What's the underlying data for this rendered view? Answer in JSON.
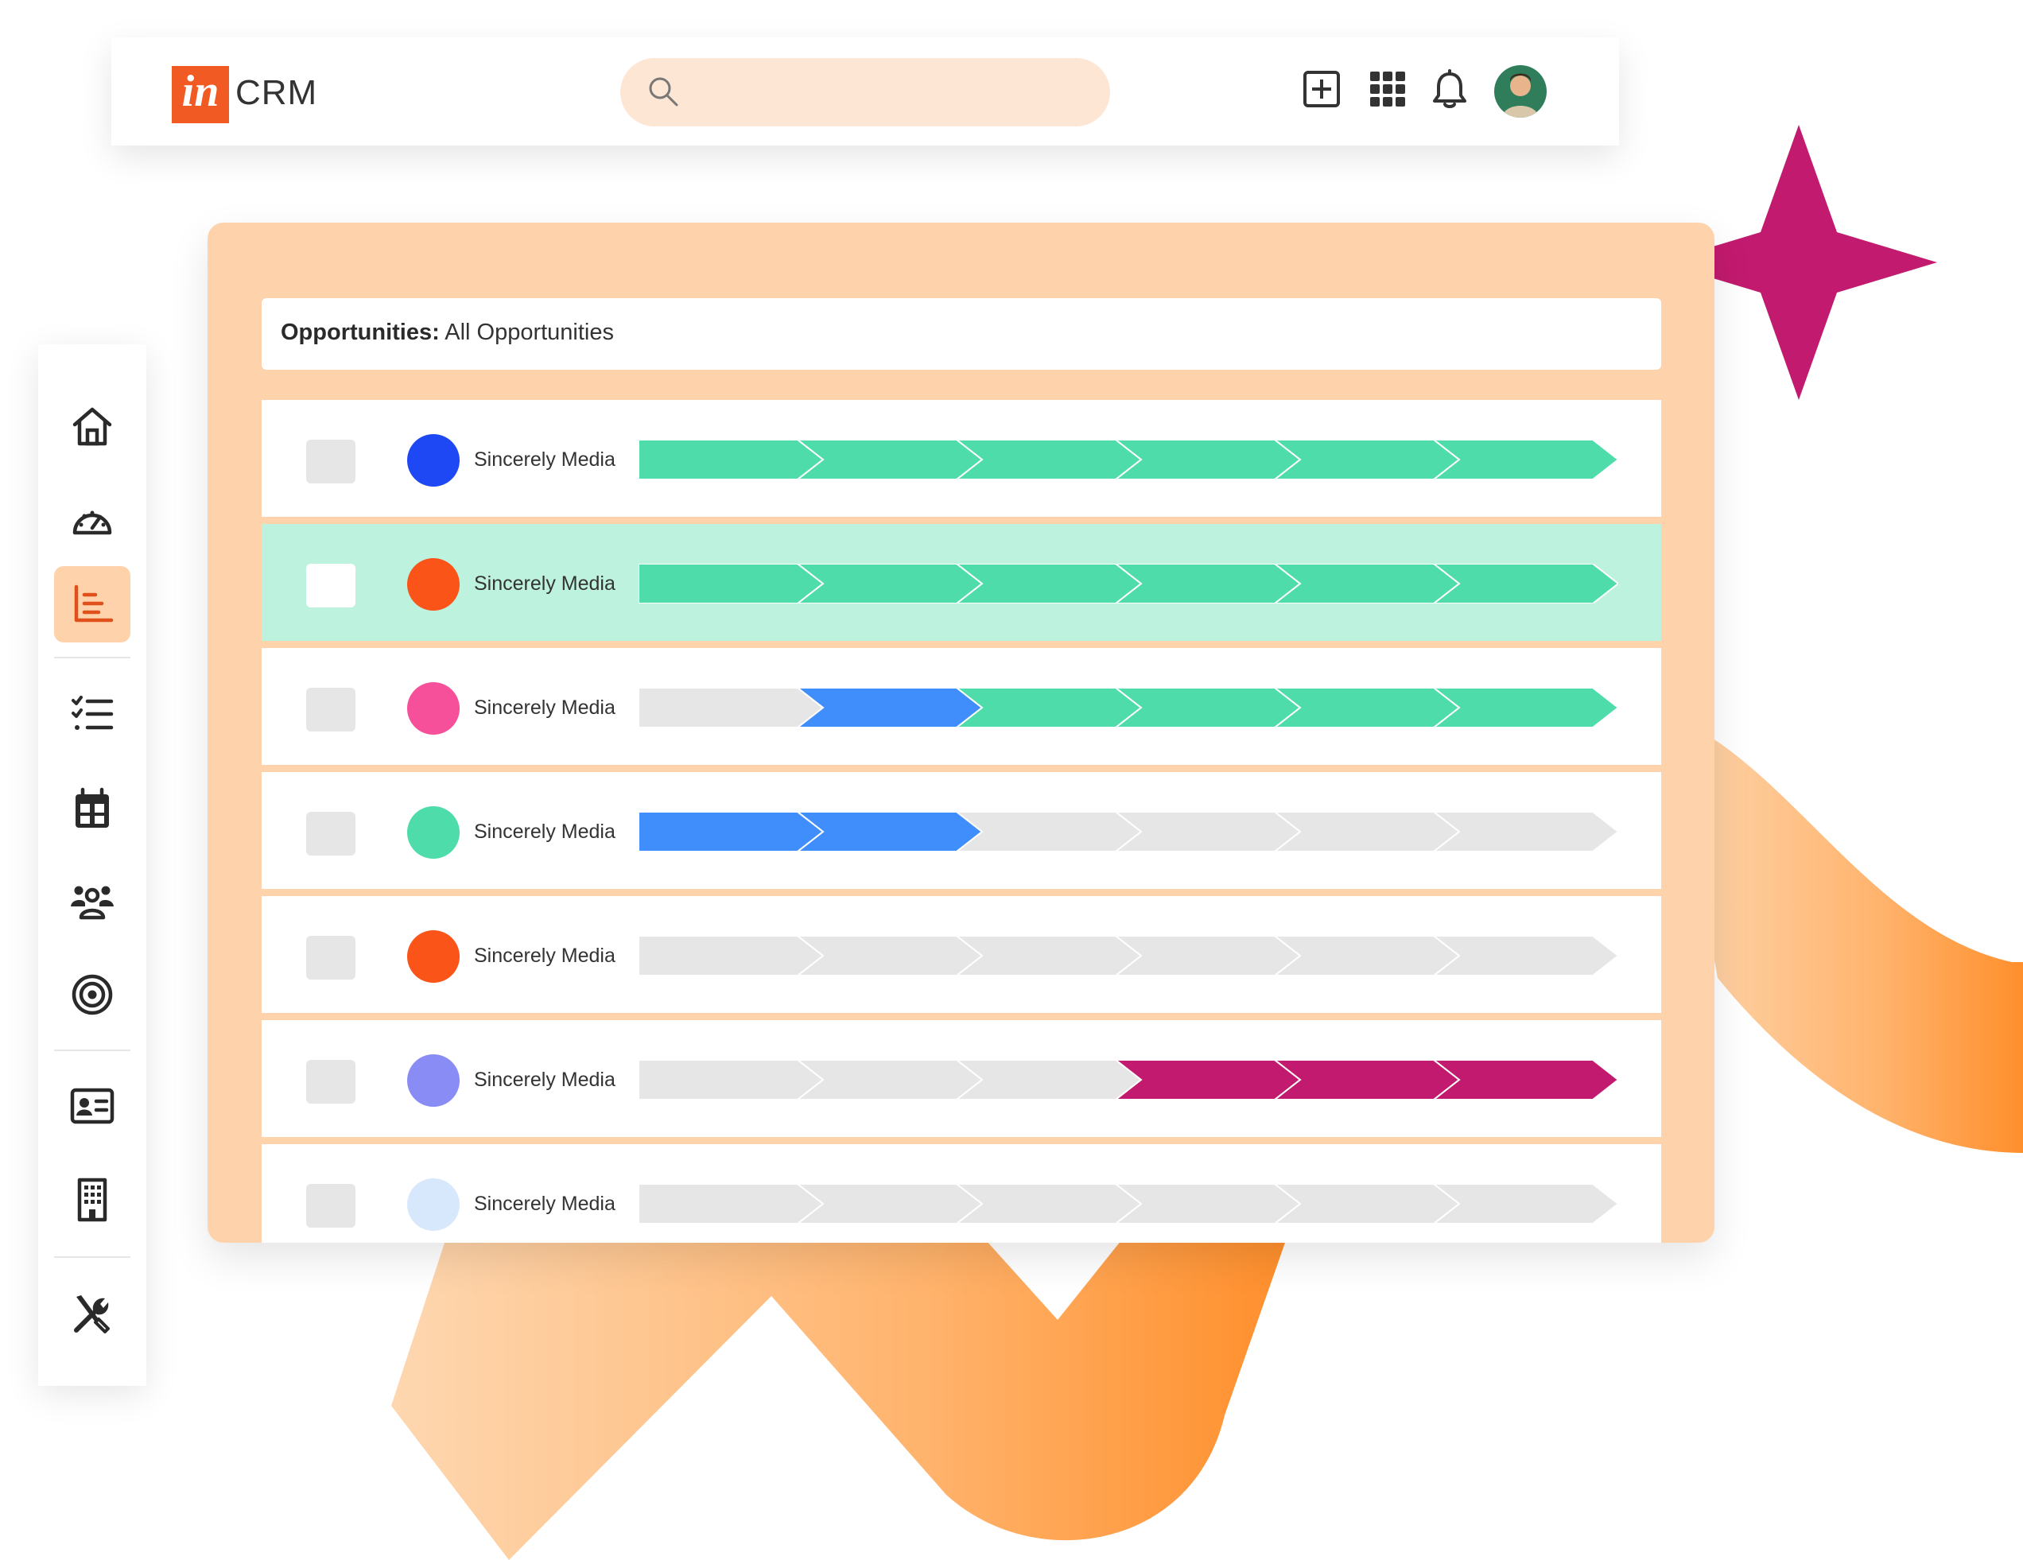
{
  "header": {
    "logo_mark": "in",
    "logo_text": "CRM",
    "search": {
      "placeholder": "",
      "value": ""
    },
    "icons": [
      "add-square-icon",
      "apps-grid-icon",
      "bell-icon",
      "user-avatar"
    ]
  },
  "sidebar": {
    "items": [
      {
        "name": "home",
        "icon": "home-icon",
        "active": false
      },
      {
        "name": "dashboard",
        "icon": "gauge-icon",
        "active": false
      },
      {
        "name": "reports",
        "icon": "bar-chart-icon",
        "active": true
      },
      {
        "name": "tasks",
        "icon": "checklist-icon",
        "active": false
      },
      {
        "name": "calendar",
        "icon": "calendar-icon",
        "active": false
      },
      {
        "name": "contacts",
        "icon": "people-icon",
        "active": false
      },
      {
        "name": "goals",
        "icon": "target-icon",
        "active": false
      },
      {
        "name": "cards",
        "icon": "id-card-icon",
        "active": false
      },
      {
        "name": "companies",
        "icon": "building-icon",
        "active": false
      },
      {
        "name": "tools",
        "icon": "tools-icon",
        "active": false
      }
    ]
  },
  "opportunities": {
    "title_label": "Opportunities:",
    "title_value": "All Opportunities",
    "stage_count": 6,
    "colors": {
      "green": "#4edcab",
      "blue": "#3f8efc",
      "magenta": "#c21a6e",
      "gray": "#e6e6e6"
    },
    "rows": [
      {
        "name": "Sincerely Media",
        "dot_color": "#1f48f5",
        "selected": false,
        "stages": [
          "green",
          "green",
          "green",
          "green",
          "green",
          "green"
        ]
      },
      {
        "name": "Sincerely Media",
        "dot_color": "#fa5418",
        "selected": true,
        "stages": [
          "green",
          "green",
          "green",
          "green",
          "green",
          "green"
        ]
      },
      {
        "name": "Sincerely Media",
        "dot_color": "#f7509a",
        "selected": false,
        "stages": [
          "gray",
          "blue",
          "green",
          "green",
          "green",
          "green"
        ]
      },
      {
        "name": "Sincerely Media",
        "dot_color": "#4edcab",
        "selected": false,
        "stages": [
          "blue",
          "blue",
          "gray",
          "gray",
          "gray",
          "gray"
        ]
      },
      {
        "name": "Sincerely Media",
        "dot_color": "#fa5418",
        "selected": false,
        "stages": [
          "gray",
          "gray",
          "gray",
          "gray",
          "gray",
          "gray"
        ]
      },
      {
        "name": "Sincerely Media",
        "dot_color": "#8a8cf5",
        "selected": false,
        "stages": [
          "gray",
          "gray",
          "gray",
          "magenta",
          "magenta",
          "magenta"
        ]
      },
      {
        "name": "Sincerely Media",
        "dot_color": "#d8e8fc",
        "selected": false,
        "stages": [
          "gray",
          "gray",
          "gray",
          "gray",
          "gray",
          "gray"
        ]
      }
    ]
  }
}
